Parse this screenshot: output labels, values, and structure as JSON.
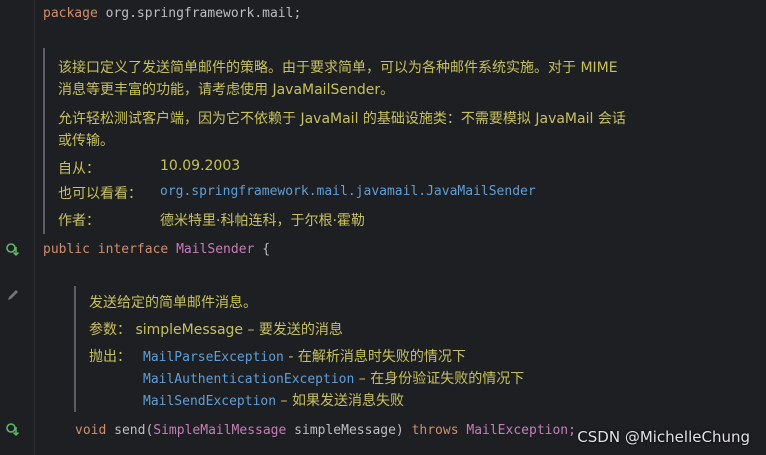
{
  "code": {
    "package_kw": "package",
    "package_name": "org.springframework.mail;",
    "public_kw": "public",
    "interface_kw": "interface",
    "interface_name": "MailSender",
    "brace_open": "{",
    "void_kw": "void",
    "method_name": "send(",
    "param_type": "SimpleMailMessage",
    "param_name": "simpleMessage)",
    "throws_kw": "throws",
    "exception_type": "MailException;"
  },
  "interface_doc": {
    "para1_line1": "该接口定义了发送简单邮件的策略。由于要求简单，可以为各种邮件系统实施。对于 MIME",
    "para1_line2": "消息等更丰富的功能，请考虑使用 JavaMailSender。",
    "para2_line1": "允许轻松测试客户端，因为它不依赖于 JavaMail 的基础设施类：不需要模拟 JavaMail 会话",
    "para2_line2": "或传输。",
    "since_label": "自从：",
    "since_value": "10.09.2003",
    "see_label": "也可以看看：",
    "see_value": "org.springframework.mail.javamail.JavaMailSender",
    "author_label": "作者：",
    "author_value": "德米特里·科帕连科，于尔根·霍勒"
  },
  "method_doc": {
    "summary": "发送给定的简单邮件消息。",
    "params_label": "参数：",
    "param_name": "simpleMessage",
    "param_desc": " – 要发送的消息",
    "throws_label": "抛出：",
    "throws": [
      {
        "type": "MailParseException",
        "desc": " - 在解析消息时失败的情况下"
      },
      {
        "type": "MailAuthenticationException",
        "desc": " – 在身份验证失败的情况下"
      },
      {
        "type": "MailSendException",
        "desc": " – 如果发送消息失败"
      }
    ]
  },
  "gutter": {
    "icon1": "implementations-icon",
    "icon2": "edit-pencil-icon",
    "icon3": "implementations-icon"
  },
  "watermark": "CSDN @MichelleChung"
}
